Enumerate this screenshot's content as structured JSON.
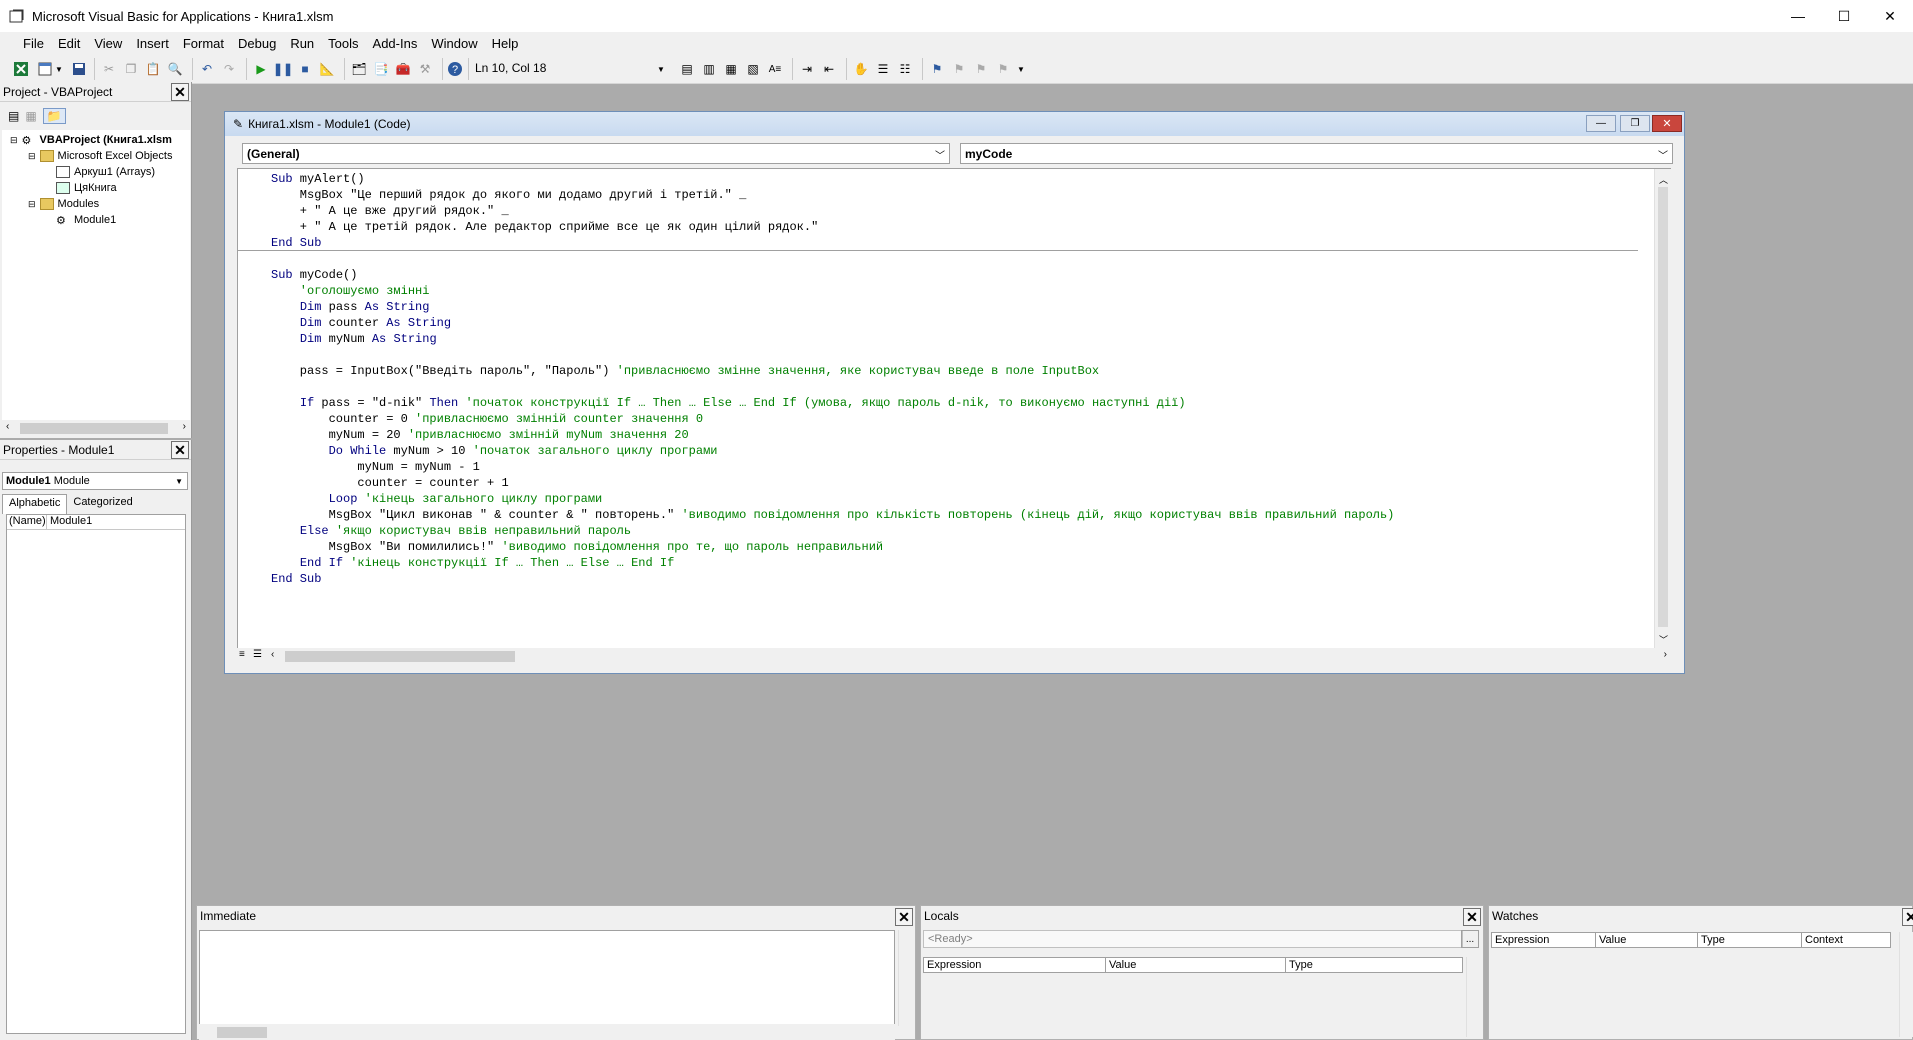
{
  "window": {
    "title": "Microsoft Visual Basic for Applications - Книга1.xlsm",
    "minimize": "—",
    "maximize": "☐",
    "close": "✕"
  },
  "menu": [
    "File",
    "Edit",
    "View",
    "Insert",
    "Format",
    "Debug",
    "Run",
    "Tools",
    "Add-Ins",
    "Window",
    "Help"
  ],
  "toolbar": {
    "position": "Ln 10, Col 18"
  },
  "project": {
    "title": "Project - VBAProject",
    "tree": [
      {
        "label": "VBAProject (Книга1.xlsm",
        "level": 0,
        "bold": true
      },
      {
        "label": "Microsoft Excel Objects",
        "level": 1
      },
      {
        "label": "Аркуш1 (Arrays)",
        "level": 2
      },
      {
        "label": "ЦяКнига",
        "level": 2
      },
      {
        "label": "Modules",
        "level": 1
      },
      {
        "label": "Module1",
        "level": 2
      }
    ]
  },
  "properties": {
    "title": "Properties - Module1",
    "object_name": "Module1",
    "object_type": "Module",
    "tabs": [
      "Alphabetic",
      "Categorized"
    ],
    "row_name": "(Name)",
    "row_value": "Module1"
  },
  "code_window": {
    "title": "Книга1.xlsm - Module1 (Code)",
    "object_combo": "(General)",
    "proc_combo": "myCode",
    "lines": [
      {
        "segments": [
          {
            "t": "Sub",
            "c": "kw"
          },
          {
            "t": " myAlert()",
            "c": ""
          }
        ]
      },
      {
        "segments": [
          {
            "t": "    MsgBox \"Це перший рядок до якого ми додамо другий і третій.\" _",
            "c": ""
          }
        ]
      },
      {
        "segments": [
          {
            "t": "    + \" А це вже другий рядок.\" _",
            "c": ""
          }
        ]
      },
      {
        "segments": [
          {
            "t": "    + \" А це третій рядок. Але редактор сприйме все це як один цілий рядок.\"",
            "c": ""
          }
        ]
      },
      {
        "segments": [
          {
            "t": "End Sub",
            "c": "kw"
          }
        ]
      },
      {
        "segments": [
          {
            "t": "",
            "c": ""
          }
        ]
      },
      {
        "segments": [
          {
            "t": "Sub",
            "c": "kw"
          },
          {
            "t": " myCode()",
            "c": ""
          }
        ]
      },
      {
        "segments": [
          {
            "t": "    'оголошуємо змінні",
            "c": "cm"
          }
        ]
      },
      {
        "segments": [
          {
            "t": "    ",
            "c": ""
          },
          {
            "t": "Dim",
            "c": "kw"
          },
          {
            "t": " pass ",
            "c": ""
          },
          {
            "t": "As String",
            "c": "kw"
          }
        ]
      },
      {
        "segments": [
          {
            "t": "    ",
            "c": ""
          },
          {
            "t": "Dim",
            "c": "kw"
          },
          {
            "t": " counter ",
            "c": ""
          },
          {
            "t": "As String",
            "c": "kw"
          }
        ]
      },
      {
        "segments": [
          {
            "t": "    ",
            "c": ""
          },
          {
            "t": "Dim",
            "c": "kw"
          },
          {
            "t": " myNum ",
            "c": ""
          },
          {
            "t": "As String",
            "c": "kw"
          }
        ]
      },
      {
        "segments": [
          {
            "t": "",
            "c": ""
          }
        ]
      },
      {
        "segments": [
          {
            "t": "    pass = InputBox(\"Введіть пароль\", \"Пароль\") ",
            "c": ""
          },
          {
            "t": "'привласнюємо змінне значення, яке користувач введе в поле InputBox",
            "c": "cm"
          }
        ]
      },
      {
        "segments": [
          {
            "t": "",
            "c": ""
          }
        ]
      },
      {
        "segments": [
          {
            "t": "    ",
            "c": ""
          },
          {
            "t": "If",
            "c": "kw"
          },
          {
            "t": " pass = \"d-nik\" ",
            "c": ""
          },
          {
            "t": "Then",
            "c": "kw"
          },
          {
            "t": " 'початок конструкції If … Then … Else … End If (умова, якщо пароль d-nik, то виконуємо наступні дії)",
            "c": "cm"
          }
        ]
      },
      {
        "segments": [
          {
            "t": "        counter = 0 ",
            "c": ""
          },
          {
            "t": "'привласнюємо змінній counter значення 0",
            "c": "cm"
          }
        ]
      },
      {
        "segments": [
          {
            "t": "        myNum = 20 ",
            "c": ""
          },
          {
            "t": "'привласнюємо змінній myNum значення 20",
            "c": "cm"
          }
        ]
      },
      {
        "segments": [
          {
            "t": "        ",
            "c": ""
          },
          {
            "t": "Do While",
            "c": "kw"
          },
          {
            "t": " myNum > 10 ",
            "c": ""
          },
          {
            "t": "'початок загального циклу програми",
            "c": "cm"
          }
        ]
      },
      {
        "segments": [
          {
            "t": "            myNum = myNum - 1",
            "c": ""
          }
        ]
      },
      {
        "segments": [
          {
            "t": "            counter = counter + 1",
            "c": ""
          }
        ]
      },
      {
        "segments": [
          {
            "t": "        ",
            "c": ""
          },
          {
            "t": "Loop",
            "c": "kw"
          },
          {
            "t": " 'кінець загального циклу програми",
            "c": "cm"
          }
        ]
      },
      {
        "segments": [
          {
            "t": "        MsgBox \"Цикл виконав \" & counter & \" повторень.\" ",
            "c": ""
          },
          {
            "t": "'виводимо повідомлення про кількість повторень (кінець дій, якщо користувач ввів правильний пароль)",
            "c": "cm"
          }
        ]
      },
      {
        "segments": [
          {
            "t": "    ",
            "c": ""
          },
          {
            "t": "Else",
            "c": "kw"
          },
          {
            "t": " 'якщо користувач ввів неправильний пароль",
            "c": "cm"
          }
        ]
      },
      {
        "segments": [
          {
            "t": "        MsgBox \"Ви помилились!\" ",
            "c": ""
          },
          {
            "t": "'виводимо повідомлення про те, що пароль неправильний",
            "c": "cm"
          }
        ]
      },
      {
        "segments": [
          {
            "t": "    ",
            "c": ""
          },
          {
            "t": "End If",
            "c": "kw"
          },
          {
            "t": " 'кінець конструкції If … Then … Else … End If",
            "c": "cm"
          }
        ]
      },
      {
        "segments": [
          {
            "t": "End Sub",
            "c": "kw"
          }
        ]
      }
    ]
  },
  "immediate": {
    "title": "Immediate"
  },
  "locals": {
    "title": "Locals",
    "status": "<Ready>",
    "ellipsis": "...",
    "columns": [
      "Expression",
      "Value",
      "Type"
    ]
  },
  "watches": {
    "title": "Watches",
    "columns": [
      "Expression",
      "Value",
      "Type",
      "Context"
    ]
  },
  "colors": {
    "keyword": "#00007f",
    "comment": "#008000",
    "workspace": "#ababab"
  }
}
